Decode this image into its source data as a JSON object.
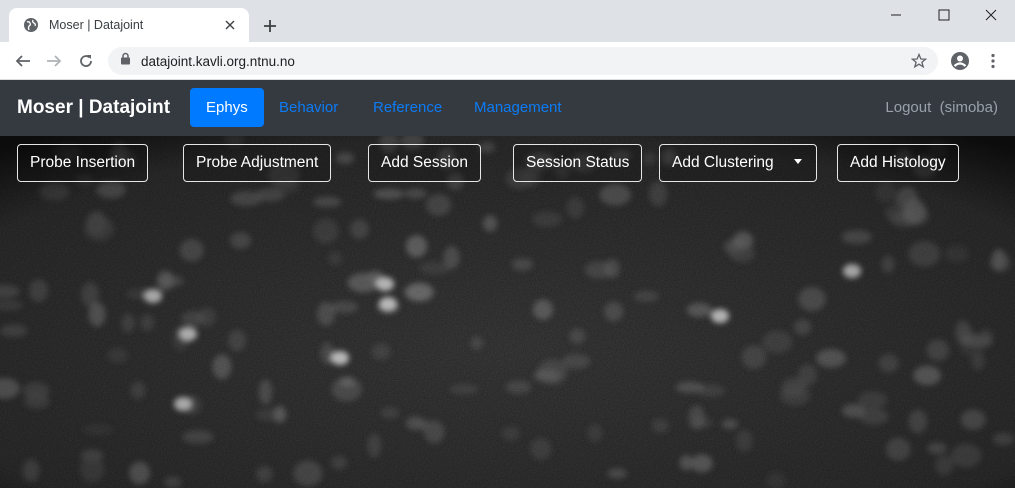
{
  "browser": {
    "tab_title": "Moser | Datajoint",
    "url": "datajoint.kavli.org.ntnu.no",
    "icons": {
      "favicon": "globe-icon",
      "tab_close": "close-icon",
      "new_tab": "plus-icon",
      "minimize": "minimize-icon",
      "maximize": "maximize-icon",
      "close_window": "close-icon",
      "back": "back-arrow-icon",
      "forward": "forward-arrow-icon",
      "reload": "reload-icon",
      "lock": "lock-icon",
      "bookmark": "star-icon",
      "profile": "account-icon",
      "menu": "kebab-menu-icon"
    }
  },
  "navbar": {
    "brand": "Moser | Datajoint",
    "links": [
      {
        "label": "Ephys",
        "active": true
      },
      {
        "label": "Behavior",
        "active": false
      },
      {
        "label": "Reference",
        "active": false
      },
      {
        "label": "Management",
        "active": false
      }
    ],
    "logout": "Logout",
    "user": "(simoba)"
  },
  "actions": [
    {
      "label": "Probe Insertion"
    },
    {
      "label": "Probe Adjustment"
    },
    {
      "label": "Add Session"
    },
    {
      "label": "Session Status"
    },
    {
      "label": "Add Clustering",
      "dropdown": true
    },
    {
      "label": "Add Histology"
    }
  ],
  "colors": {
    "navbar_bg": "#343a40",
    "active_nav": "#007bff",
    "link": "#0d7bf5",
    "tabstrip": "#dee1e6"
  }
}
